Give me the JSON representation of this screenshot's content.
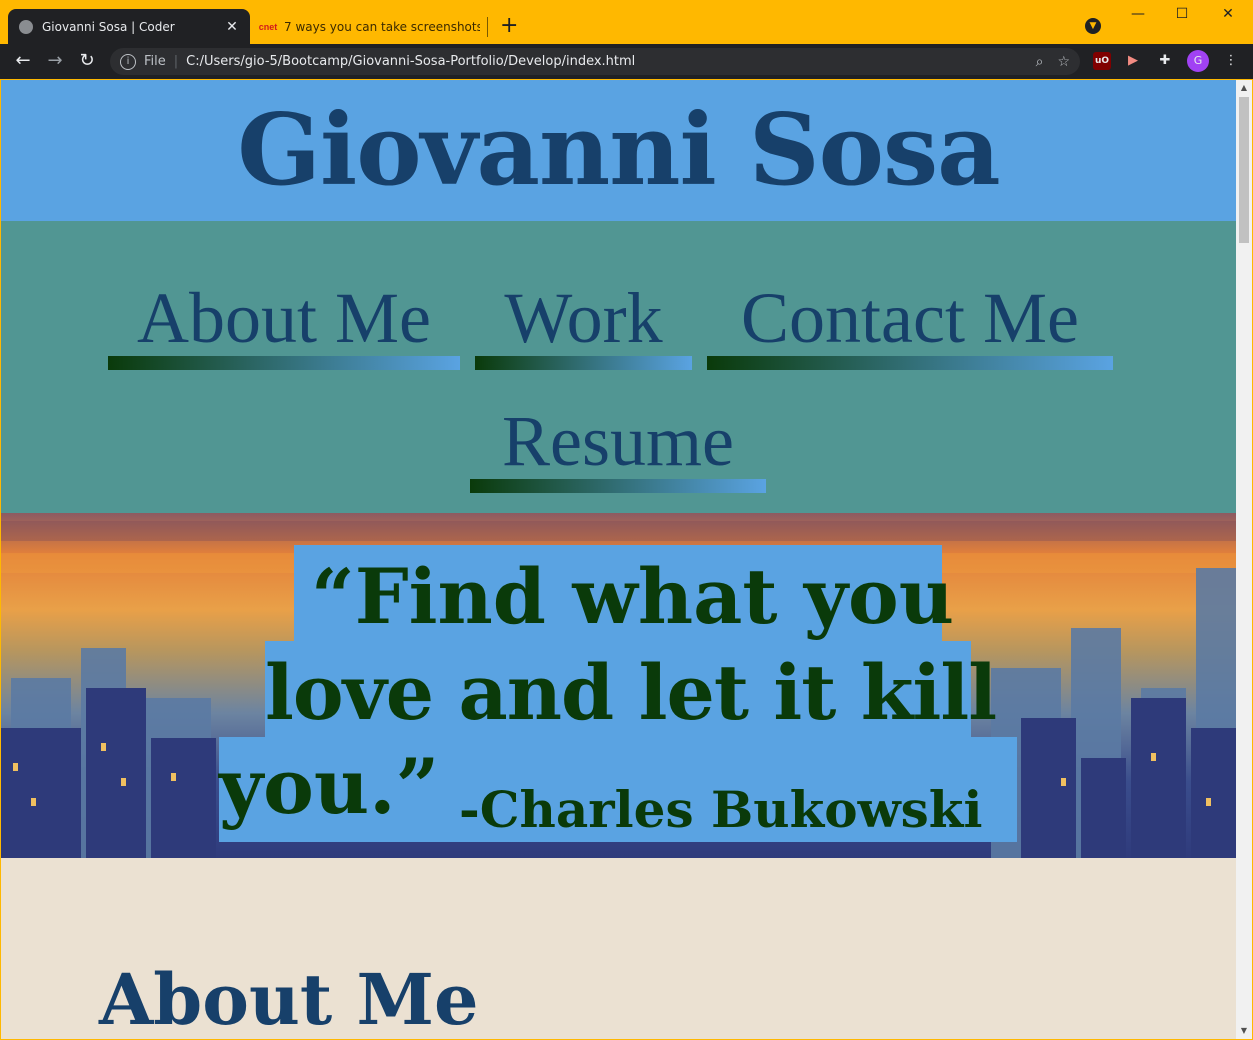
{
  "browser": {
    "tabs": [
      {
        "title": "Giovanni Sosa | Coder",
        "active": true
      },
      {
        "title": "7 ways you can take screenshots",
        "favicon_text": "cnet",
        "active": false
      }
    ],
    "new_tab_label": "+",
    "address": {
      "scheme": "File",
      "url": "C:/Users/gio-5/Bootcamp/Giovanni-Sosa-Portfolio/Develop/index.html"
    },
    "profile_initial": "G",
    "extension_badge": "uO"
  },
  "site": {
    "name": "Giovanni Sosa",
    "nav": [
      "About Me",
      "Work",
      "Contact Me",
      "Resume"
    ],
    "quote": {
      "line1": "“Find what you",
      "line2": "love and let it kill",
      "line3": "you.”",
      "author": "-Charles Bukowski"
    },
    "about_heading": "About Me"
  },
  "colors": {
    "header_bg": "#5aa3e2",
    "nav_bg": "#519693",
    "heading_text": "#17406a",
    "quote_text": "#0a3a0a",
    "page_bg": "#ebe1d2",
    "browser_frame": "#ffb800"
  }
}
